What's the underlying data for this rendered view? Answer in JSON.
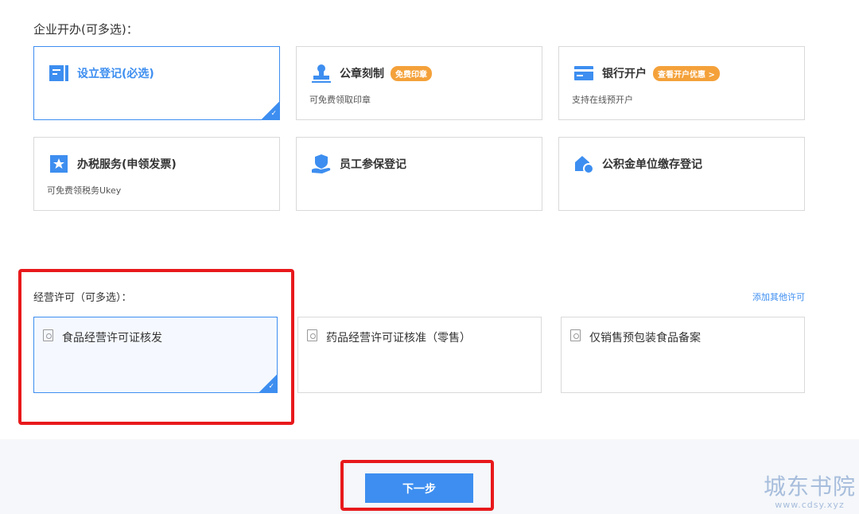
{
  "sections": {
    "enterprise": {
      "title": "企业开办(可多选)："
    },
    "license": {
      "title": "经营许可（可多选）：",
      "add_link": "添加其他许可"
    }
  },
  "enterprise_cards": [
    {
      "label": "设立登记(必选)",
      "sub": "",
      "badge": "",
      "icon": "form-icon",
      "selected": true
    },
    {
      "label": "公章刻制",
      "sub": "可免费领取印章",
      "badge": "免费印章",
      "icon": "stamp-icon",
      "selected": false
    },
    {
      "label": "银行开户",
      "sub": "支持在线预开户",
      "badge": "查看开户优惠 >",
      "icon": "bank-card-icon",
      "selected": false
    },
    {
      "label": "办税服务(申领发票)",
      "sub": "可免费领税务Ukey",
      "badge": "",
      "icon": "tax-star-icon",
      "selected": false
    },
    {
      "label": "员工参保登记",
      "sub": "",
      "badge": "",
      "icon": "shield-hand-icon",
      "selected": false
    },
    {
      "label": "公积金单位缴存登记",
      "sub": "",
      "badge": "",
      "icon": "house-coin-icon",
      "selected": false
    }
  ],
  "license_cards": [
    {
      "label": "食品经营许可证核发",
      "icon": "document-icon",
      "selected": true
    },
    {
      "label": "药品经营许可证核准（零售）",
      "icon": "document-icon",
      "selected": false
    },
    {
      "label": "仅销售预包装食品备案",
      "icon": "document-icon",
      "selected": false
    }
  ],
  "check_mark": "✓",
  "footer": {
    "next_button": "下一步"
  },
  "watermark": {
    "main": "城东书院",
    "sub": "www.cdsy.xyz"
  },
  "colors": {
    "accent": "#3d8ef0",
    "badge": "#f4a13a",
    "highlight": "#e8191c"
  }
}
